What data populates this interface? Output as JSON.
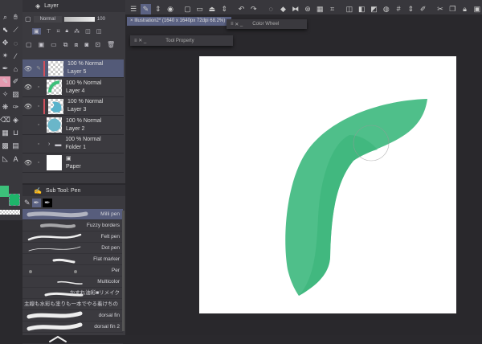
{
  "app": {
    "accent": "#5b6283",
    "brush_color": "#1eb56a"
  },
  "document_tab": {
    "title": "Illustration2* (1640 x 1640px 72dpi 68.2%)",
    "close": "×"
  },
  "tool_property": {
    "title": "Tool Property"
  },
  "color_wheel": {
    "title": "Color Wheel"
  },
  "layer_panel": {
    "title": "Layer",
    "blend_mode": "Normal",
    "opacity": "100",
    "layers": [
      {
        "opacity": "100 %",
        "mode": "Normal",
        "name": "Layer 5",
        "selected": true,
        "visible": true,
        "thumb": "empty"
      },
      {
        "opacity": "100 %",
        "mode": "Normal",
        "name": "Layer 4",
        "selected": false,
        "visible": true,
        "thumb": "green-stroke"
      },
      {
        "opacity": "100 %",
        "mode": "Normal",
        "name": "Layer 3",
        "selected": false,
        "visible": true,
        "thumb": "blue-blob"
      },
      {
        "opacity": "100 %",
        "mode": "Normal",
        "name": "Layer 2",
        "selected": false,
        "visible": false,
        "thumb": "blue-circle"
      },
      {
        "opacity": "100 %",
        "mode": "Normal",
        "name": "Folder 1",
        "selected": false,
        "visible": false,
        "thumb": "folder"
      },
      {
        "opacity": "",
        "mode": "",
        "name": "Paper",
        "selected": false,
        "visible": true,
        "thumb": "paper"
      }
    ]
  },
  "sub_tool": {
    "title": "Sub Tool: Pen",
    "brushes": [
      "Milli pen",
      "Fuzzy borders",
      "Felt pen",
      "Dot pen",
      "Flat marker",
      "Per",
      "Multicolor",
      "かすれ油彩■リメイク",
      "主線も水彩も塗りも一本でやる着けちの",
      "dorsal fin",
      "dorsal fin 2",
      ""
    ]
  },
  "colors": {
    "main": "#3cc07a",
    "sub": "#1eb56a"
  }
}
